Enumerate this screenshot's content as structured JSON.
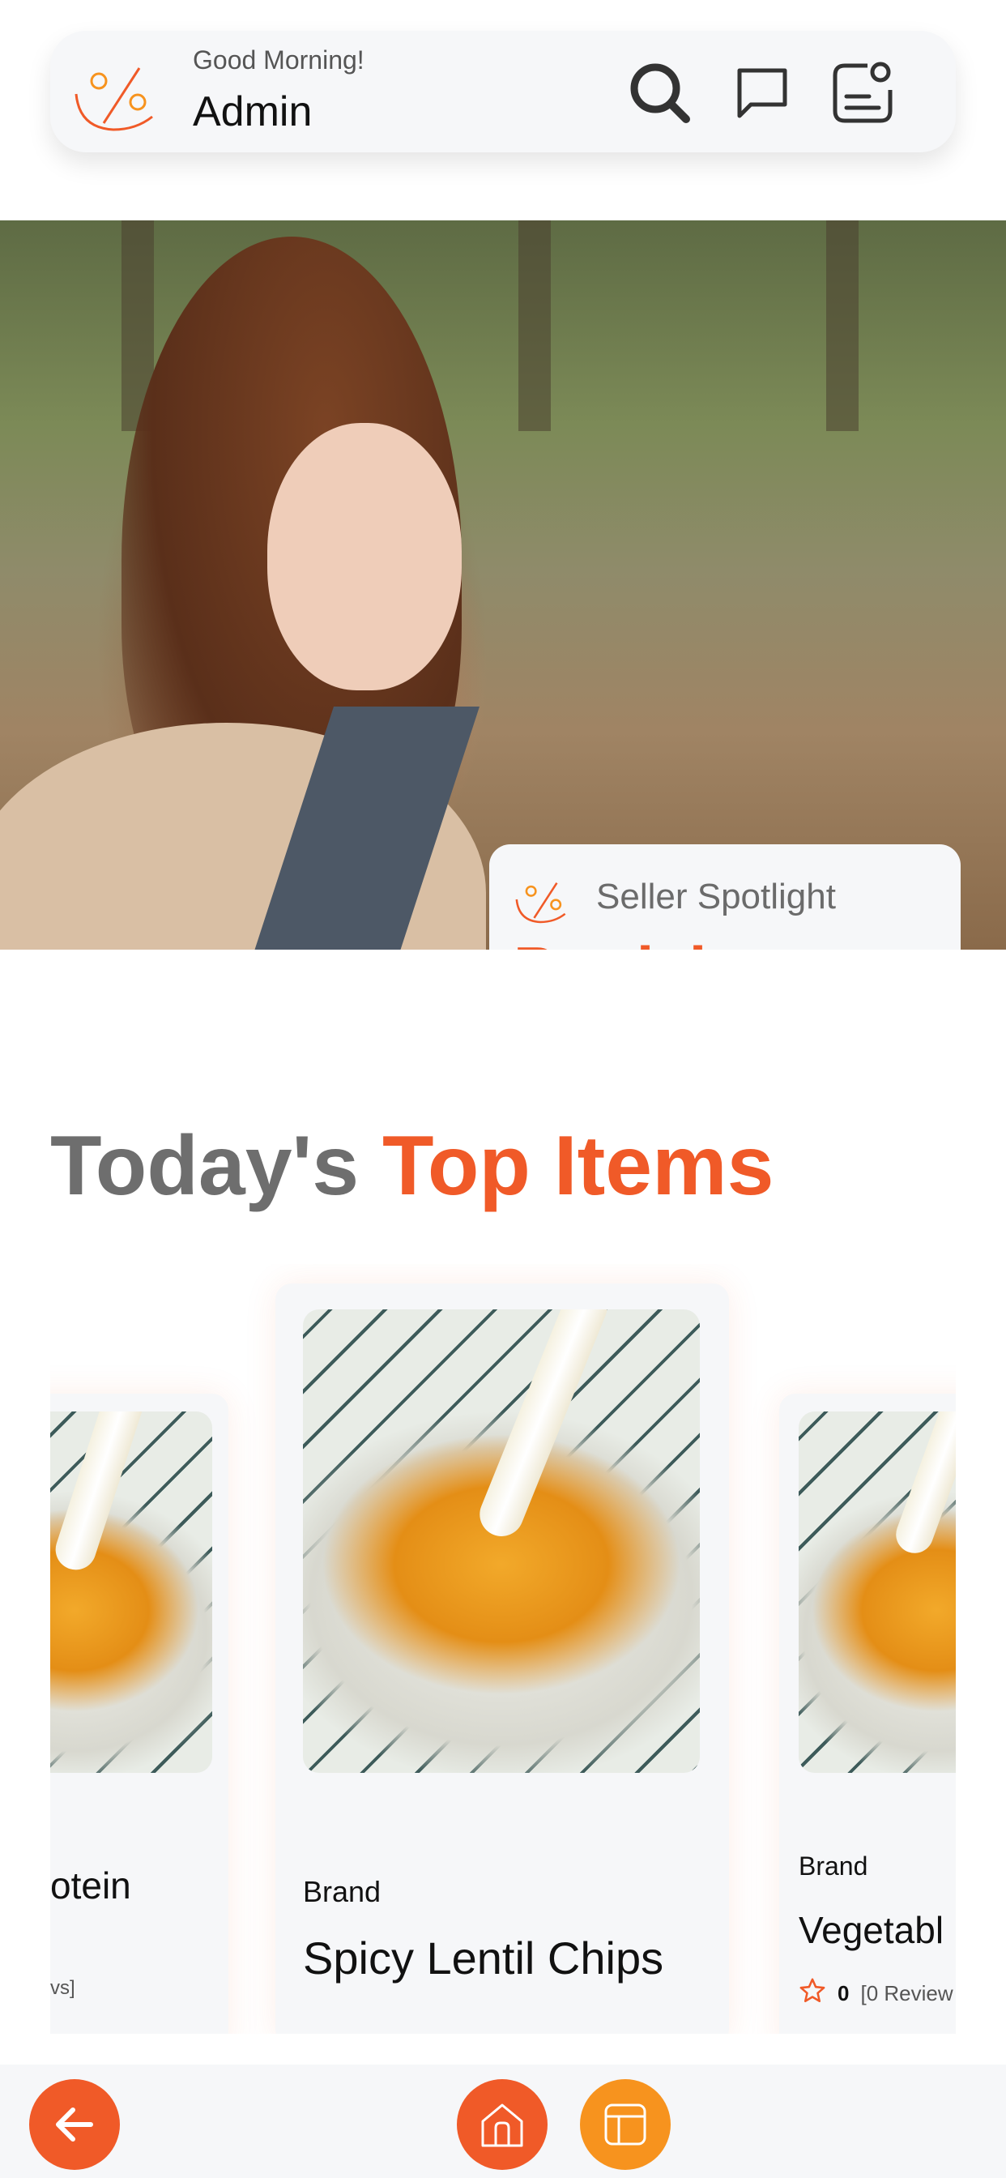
{
  "header": {
    "greeting": "Good Morning!",
    "username": "Admin",
    "icons": [
      "search-icon",
      "chat-icon",
      "notification-icon"
    ]
  },
  "hero": {
    "spotlight_label": "Seller Spotlight",
    "seller_name": "Patricia Adamson"
  },
  "section": {
    "title_part1": "Today's ",
    "title_part2": "Top Items"
  },
  "carousel": {
    "cards": [
      {
        "brand": "",
        "name": "otein",
        "rating_text": "vs]"
      },
      {
        "brand": "Brand",
        "name": "Spicy Lentil Chips",
        "rating_value": "",
        "rating_count": ""
      },
      {
        "brand": "Brand",
        "name": "Vegetabl",
        "rating_value": "0",
        "rating_count": "[0 Review"
      }
    ]
  },
  "colors": {
    "accent": "#f05a28",
    "accent_secondary": "#f7931e",
    "surface": "#f6f7f9",
    "muted_text": "#6e6e6e"
  }
}
